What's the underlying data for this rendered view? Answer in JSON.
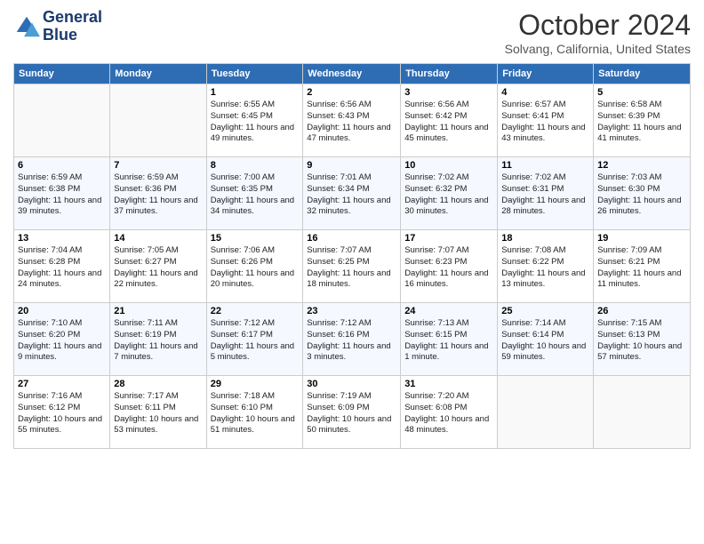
{
  "logo": {
    "line1": "General",
    "line2": "Blue"
  },
  "title": "October 2024",
  "subtitle": "Solvang, California, United States",
  "headers": [
    "Sunday",
    "Monday",
    "Tuesday",
    "Wednesday",
    "Thursday",
    "Friday",
    "Saturday"
  ],
  "weeks": [
    [
      {
        "day": "",
        "info": ""
      },
      {
        "day": "",
        "info": ""
      },
      {
        "day": "1",
        "info": "Sunrise: 6:55 AM\nSunset: 6:45 PM\nDaylight: 11 hours and 49 minutes."
      },
      {
        "day": "2",
        "info": "Sunrise: 6:56 AM\nSunset: 6:43 PM\nDaylight: 11 hours and 47 minutes."
      },
      {
        "day": "3",
        "info": "Sunrise: 6:56 AM\nSunset: 6:42 PM\nDaylight: 11 hours and 45 minutes."
      },
      {
        "day": "4",
        "info": "Sunrise: 6:57 AM\nSunset: 6:41 PM\nDaylight: 11 hours and 43 minutes."
      },
      {
        "day": "5",
        "info": "Sunrise: 6:58 AM\nSunset: 6:39 PM\nDaylight: 11 hours and 41 minutes."
      }
    ],
    [
      {
        "day": "6",
        "info": "Sunrise: 6:59 AM\nSunset: 6:38 PM\nDaylight: 11 hours and 39 minutes."
      },
      {
        "day": "7",
        "info": "Sunrise: 6:59 AM\nSunset: 6:36 PM\nDaylight: 11 hours and 37 minutes."
      },
      {
        "day": "8",
        "info": "Sunrise: 7:00 AM\nSunset: 6:35 PM\nDaylight: 11 hours and 34 minutes."
      },
      {
        "day": "9",
        "info": "Sunrise: 7:01 AM\nSunset: 6:34 PM\nDaylight: 11 hours and 32 minutes."
      },
      {
        "day": "10",
        "info": "Sunrise: 7:02 AM\nSunset: 6:32 PM\nDaylight: 11 hours and 30 minutes."
      },
      {
        "day": "11",
        "info": "Sunrise: 7:02 AM\nSunset: 6:31 PM\nDaylight: 11 hours and 28 minutes."
      },
      {
        "day": "12",
        "info": "Sunrise: 7:03 AM\nSunset: 6:30 PM\nDaylight: 11 hours and 26 minutes."
      }
    ],
    [
      {
        "day": "13",
        "info": "Sunrise: 7:04 AM\nSunset: 6:28 PM\nDaylight: 11 hours and 24 minutes."
      },
      {
        "day": "14",
        "info": "Sunrise: 7:05 AM\nSunset: 6:27 PM\nDaylight: 11 hours and 22 minutes."
      },
      {
        "day": "15",
        "info": "Sunrise: 7:06 AM\nSunset: 6:26 PM\nDaylight: 11 hours and 20 minutes."
      },
      {
        "day": "16",
        "info": "Sunrise: 7:07 AM\nSunset: 6:25 PM\nDaylight: 11 hours and 18 minutes."
      },
      {
        "day": "17",
        "info": "Sunrise: 7:07 AM\nSunset: 6:23 PM\nDaylight: 11 hours and 16 minutes."
      },
      {
        "day": "18",
        "info": "Sunrise: 7:08 AM\nSunset: 6:22 PM\nDaylight: 11 hours and 13 minutes."
      },
      {
        "day": "19",
        "info": "Sunrise: 7:09 AM\nSunset: 6:21 PM\nDaylight: 11 hours and 11 minutes."
      }
    ],
    [
      {
        "day": "20",
        "info": "Sunrise: 7:10 AM\nSunset: 6:20 PM\nDaylight: 11 hours and 9 minutes."
      },
      {
        "day": "21",
        "info": "Sunrise: 7:11 AM\nSunset: 6:19 PM\nDaylight: 11 hours and 7 minutes."
      },
      {
        "day": "22",
        "info": "Sunrise: 7:12 AM\nSunset: 6:17 PM\nDaylight: 11 hours and 5 minutes."
      },
      {
        "day": "23",
        "info": "Sunrise: 7:12 AM\nSunset: 6:16 PM\nDaylight: 11 hours and 3 minutes."
      },
      {
        "day": "24",
        "info": "Sunrise: 7:13 AM\nSunset: 6:15 PM\nDaylight: 11 hours and 1 minute."
      },
      {
        "day": "25",
        "info": "Sunrise: 7:14 AM\nSunset: 6:14 PM\nDaylight: 10 hours and 59 minutes."
      },
      {
        "day": "26",
        "info": "Sunrise: 7:15 AM\nSunset: 6:13 PM\nDaylight: 10 hours and 57 minutes."
      }
    ],
    [
      {
        "day": "27",
        "info": "Sunrise: 7:16 AM\nSunset: 6:12 PM\nDaylight: 10 hours and 55 minutes."
      },
      {
        "day": "28",
        "info": "Sunrise: 7:17 AM\nSunset: 6:11 PM\nDaylight: 10 hours and 53 minutes."
      },
      {
        "day": "29",
        "info": "Sunrise: 7:18 AM\nSunset: 6:10 PM\nDaylight: 10 hours and 51 minutes."
      },
      {
        "day": "30",
        "info": "Sunrise: 7:19 AM\nSunset: 6:09 PM\nDaylight: 10 hours and 50 minutes."
      },
      {
        "day": "31",
        "info": "Sunrise: 7:20 AM\nSunset: 6:08 PM\nDaylight: 10 hours and 48 minutes."
      },
      {
        "day": "",
        "info": ""
      },
      {
        "day": "",
        "info": ""
      }
    ]
  ]
}
